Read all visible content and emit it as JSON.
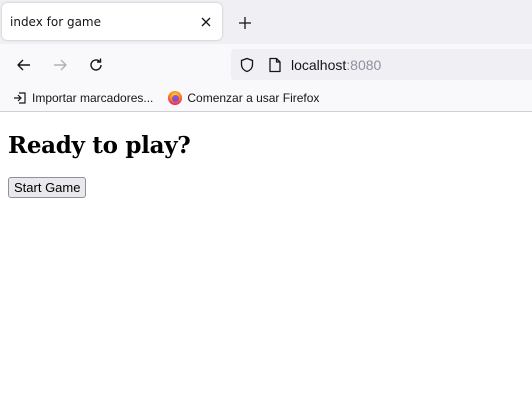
{
  "browser": {
    "tab": {
      "title": "index for game"
    },
    "url": {
      "host": "localhost",
      "port": ":8080"
    },
    "bookmarks": [
      {
        "label": "Importar marcadores..."
      },
      {
        "label": "Comenzar a usar Firefox"
      }
    ],
    "icons": {
      "tab_close": "close-icon",
      "new_tab": "plus-icon",
      "back": "back-arrow-icon",
      "forward": "forward-arrow-icon",
      "reload": "reload-icon",
      "shield": "shield-icon",
      "page": "page-icon",
      "import": "import-icon",
      "firefox": "firefox-icon"
    }
  },
  "page": {
    "heading": "Ready to play?",
    "start_button": "Start Game"
  }
}
